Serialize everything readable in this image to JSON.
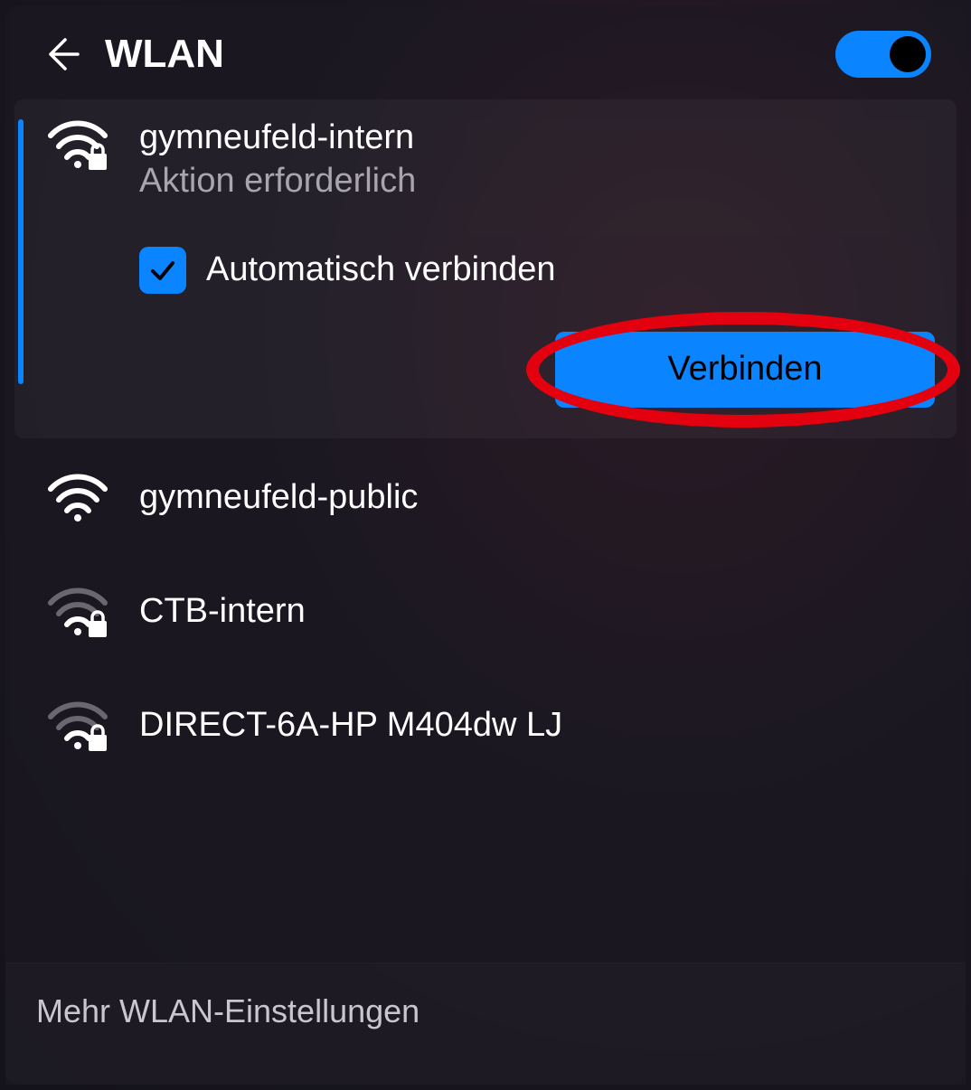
{
  "header": {
    "title": "WLAN",
    "toggle_on": true
  },
  "networks": [
    {
      "ssid": "gymneufeld-intern",
      "status": "Aktion erforderlich",
      "secured": true,
      "signal": "strong",
      "expanded": true,
      "auto_connect_label": "Automatisch verbinden",
      "auto_connect_checked": true,
      "connect_label": "Verbinden"
    },
    {
      "ssid": "gymneufeld-public",
      "secured": false,
      "signal": "strong"
    },
    {
      "ssid": "CTB-intern",
      "secured": true,
      "signal": "weak"
    },
    {
      "ssid": "DIRECT-6A-HP M404dw LJ",
      "secured": true,
      "signal": "weak"
    }
  ],
  "footer": {
    "more_settings": "Mehr WLAN-Einstellungen"
  },
  "annotation": {
    "highlight_connect": true
  }
}
